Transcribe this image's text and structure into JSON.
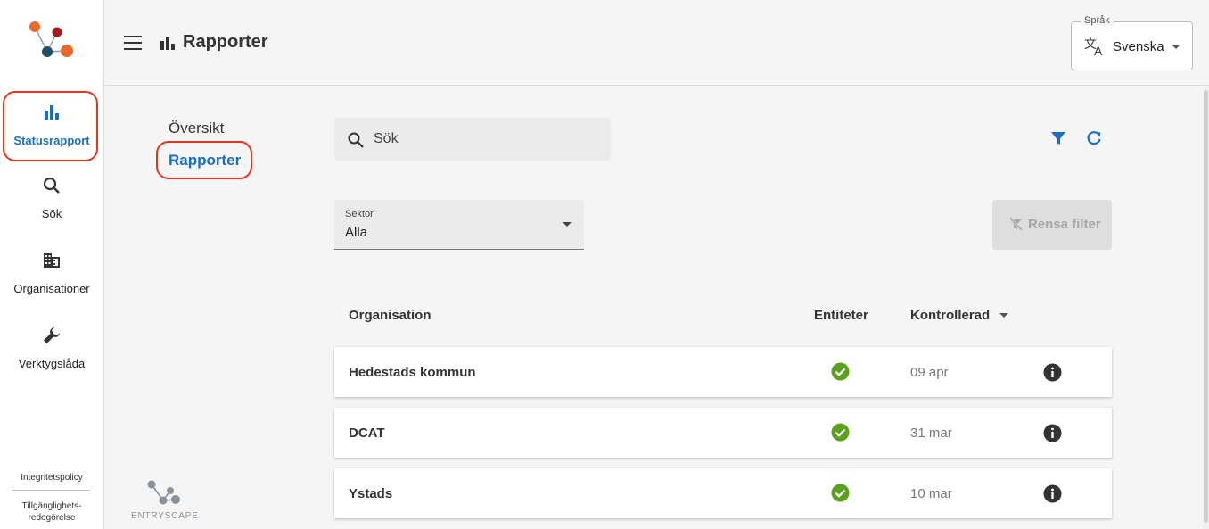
{
  "sidebar": {
    "items": [
      {
        "label": "Statusrapport",
        "icon": "bar-chart-icon",
        "active": true
      },
      {
        "label": "Sök",
        "icon": "search-icon",
        "active": false
      },
      {
        "label": "Organisationer",
        "icon": "building-icon",
        "active": false
      },
      {
        "label": "Verktygslåda",
        "icon": "wrench-icon",
        "active": false
      }
    ],
    "footer": {
      "privacy": "Integritetspolicy",
      "accessibility_line1": "Tillgänglighets-",
      "accessibility_line2": "redogörelse"
    },
    "brand": "ENTRYSCAPE"
  },
  "header": {
    "title": "Rapporter",
    "language": {
      "legend": "Språk",
      "value": "Svenska"
    }
  },
  "subnav": {
    "items": [
      {
        "label": "Översikt"
      },
      {
        "label": "Rapporter",
        "active": true
      }
    ]
  },
  "search": {
    "placeholder": "Sök"
  },
  "filters": {
    "sector_label": "Sektor",
    "sector_value": "Alla",
    "clear_label": "Rensa filter"
  },
  "table": {
    "columns": [
      "Organisation",
      "Entiteter",
      "Kontrollerad"
    ],
    "rows": [
      {
        "organisation": "Hedestads kommun",
        "date": "09 apr"
      },
      {
        "organisation": "DCAT",
        "date": "31 mar"
      },
      {
        "organisation": "Ystads",
        "date": "10 mar"
      }
    ]
  },
  "colors": {
    "accent": "#1a6fc4",
    "highlight": "#e8341c",
    "success": "#5aa21c",
    "logo_orange": "#e8692a",
    "logo_red": "#a6191c",
    "logo_navy": "#1f4e66"
  }
}
